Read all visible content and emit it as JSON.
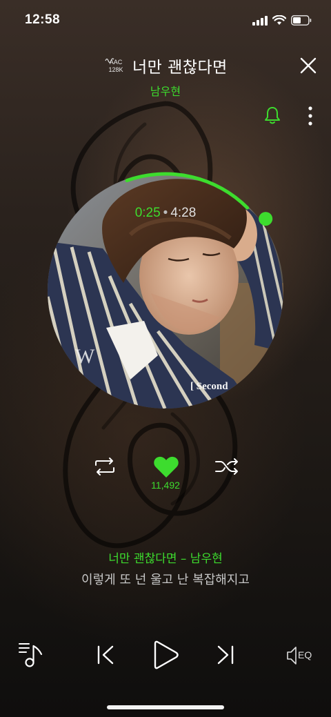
{
  "status_bar": {
    "time": "12:58"
  },
  "header": {
    "quality_codec": "AAC",
    "quality_bitrate": "128K",
    "song_title": "너만 괜찮다면",
    "artist": "남우현"
  },
  "player": {
    "current_time": "0:25",
    "separator": "•",
    "total_time": "4:28",
    "progress_fraction": 0.093,
    "like_count": "11,492",
    "liked": true
  },
  "album_art": {
    "overlay_text_left": "W",
    "overlay_text_right": "[ Second"
  },
  "lyrics": {
    "now_playing": "너만 괜찮다면 – 남우현",
    "current_line": "이렇게 또 넌 울고 난 복잡해지고"
  },
  "controls": {
    "eq_label": "EQ"
  },
  "icons": {
    "close": "close-icon",
    "bell": "bell-icon",
    "more": "more-vertical-icon",
    "repeat": "repeat-icon",
    "heart": "heart-icon",
    "shuffle": "shuffle-icon",
    "playlist": "playlist-icon",
    "prev": "previous-icon",
    "play": "play-icon",
    "next": "next-icon",
    "eq": "equalizer-icon"
  },
  "colors": {
    "accent": "#3ddc2e",
    "text": "#ffffff",
    "muted_text": "#c8c8c8"
  }
}
